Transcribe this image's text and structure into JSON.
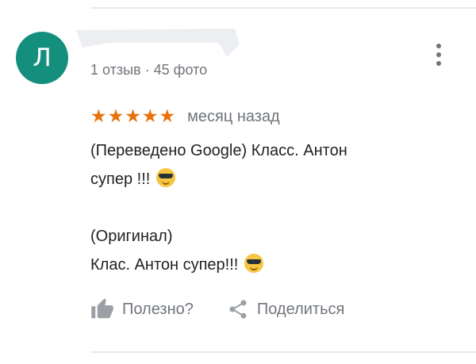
{
  "reviewer": {
    "avatar_letter": "Л",
    "meta": "1 отзыв · 45 фото"
  },
  "review": {
    "stars": "★★★★★",
    "rating": 5,
    "date": "месяц назад",
    "translated_line1": "(Переведено Google) Класс. Антон",
    "translated_line2": "супер !!!",
    "original_label": "(Оригинал)",
    "original_text": "Клас. Антон супер!!!"
  },
  "actions": {
    "helpful_label": "Полезно?",
    "share_label": "Поделиться"
  },
  "colors": {
    "avatar_bg": "#148f7e",
    "star_color": "#e8710a",
    "secondary_text": "#70757a"
  },
  "icons": [
    "more-vert-icon",
    "thumb-up-icon",
    "share-icon",
    "smiling-face-with-sunglasses-emoji"
  ]
}
